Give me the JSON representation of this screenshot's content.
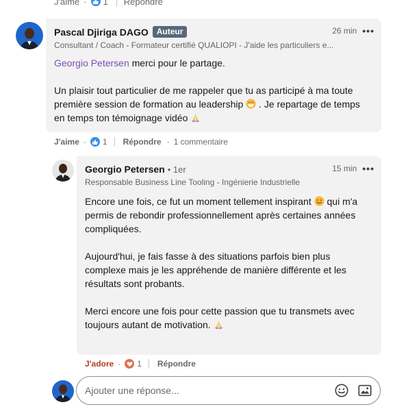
{
  "top_actions": {
    "like_label": "J'aime",
    "like_count": "1",
    "reply_label": "Répondre"
  },
  "comment": {
    "author_name": "Pascal Djiriga DAGO",
    "author_badge": "Auteur",
    "headline": "Consultant / Coach - Formateur certifié QUALIOPI - J'aide les particuliers e...",
    "time": "26 min",
    "more": "•••",
    "mention": "Georgio Petersen",
    "line1_rest": " merci pour le partage.",
    "para2_a": "Un plaisir tout particulier de me rappeler que tu as participé à ma toute première session de formation au leadership ",
    "para2_b": " . Je repartage de temps en temps ton témoignage vidéo ",
    "actions": {
      "like_label": "J'aime",
      "like_count": "1",
      "reply_label": "Répondre",
      "comments_label": "1 commentaire"
    }
  },
  "reply": {
    "author_name": "Georgio Petersen",
    "degree": "• 1er",
    "headline": "Responsable Business Line Tooling - Ingénierie Industrielle",
    "time": "15 min",
    "more": "•••",
    "para1_a": "Encore une fois, ce fut un moment tellement inspirant ",
    "para1_b": " qui m'a permis de rebondir professionnellement après certaines années compliquées.",
    "para2": "Aujourd'hui, je fais fasse à des situations parfois bien plus complexe mais je les appréhende de manière différente et les résultats sont probants.",
    "para3_a": "Merci encore une fois pour cette passion que tu transmets avec toujours autant de motivation. ",
    "actions": {
      "reaction_label": "J'adore",
      "reaction_count": "1",
      "reply_label": "Répondre"
    }
  },
  "reply_box": {
    "placeholder": "Ajouter une réponse..."
  },
  "colors": {
    "bubble_bg": "#f2f2f2",
    "mention": "#7a4fb5",
    "like_blue": "#378fe9",
    "adore_red": "#b24020",
    "badge_gray": "#56687a"
  }
}
